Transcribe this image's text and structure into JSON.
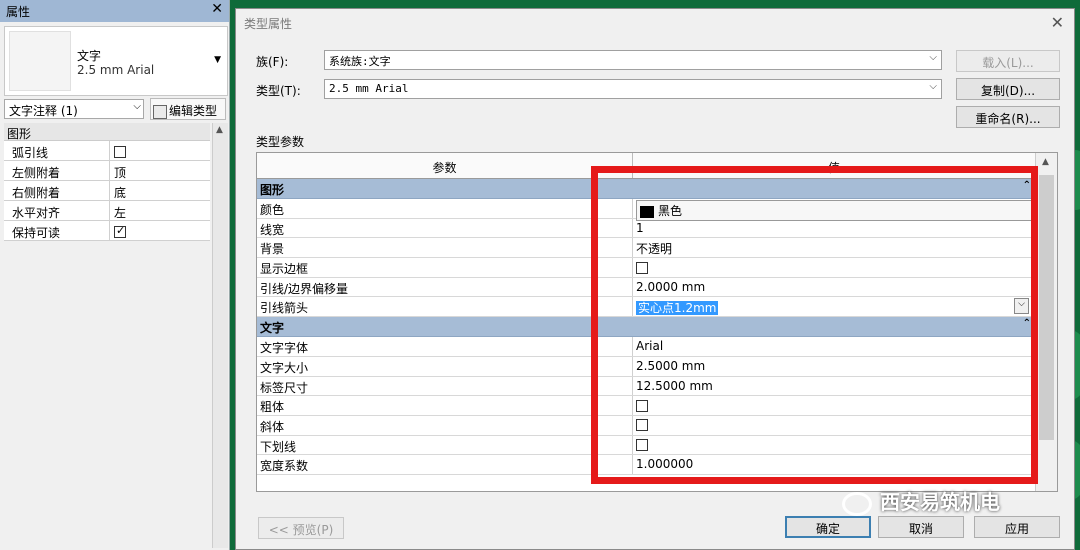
{
  "props_panel": {
    "title": "属性",
    "close_icon": "close-icon",
    "type_name": "文字",
    "type_sub": "2.5 mm Arial",
    "filter": "文字注释 (1)",
    "edit_type_label": "编辑类型",
    "section": "图形",
    "rows": [
      {
        "key": "弧引线",
        "val": ""
      },
      {
        "key": "左侧附着",
        "val": "顶"
      },
      {
        "key": "右侧附着",
        "val": "底"
      },
      {
        "key": "水平对齐",
        "val": "左"
      },
      {
        "key": "保持可读",
        "val": ""
      }
    ]
  },
  "dialog": {
    "title": "类型属性",
    "family_label": "族(F):",
    "family_value": "系统族:文字",
    "type_label": "类型(T):",
    "type_value": "2.5 mm Arial",
    "load_btn": "载入(L)...",
    "copy_btn": "复制(D)...",
    "rename_btn": "重命名(R)...",
    "type_params_label": "类型参数",
    "col_param": "参数",
    "col_value": "值",
    "sections": [
      {
        "name": "图形",
        "rows": [
          {
            "key": "颜色",
            "val": "黑色"
          },
          {
            "key": "线宽",
            "val": "1"
          },
          {
            "key": "背景",
            "val": "不透明"
          },
          {
            "key": "显示边框",
            "val": ""
          },
          {
            "key": "引线/边界偏移量",
            "val": "2.0000 mm"
          },
          {
            "key": "引线箭头",
            "val": "实心点1.2mm"
          }
        ]
      },
      {
        "name": "文字",
        "rows": [
          {
            "key": "文字字体",
            "val": "Arial"
          },
          {
            "key": "文字大小",
            "val": "2.5000 mm"
          },
          {
            "key": "标签尺寸",
            "val": "12.5000 mm"
          },
          {
            "key": "粗体",
            "val": ""
          },
          {
            "key": "斜体",
            "val": ""
          },
          {
            "key": "下划线",
            "val": ""
          },
          {
            "key": "宽度系数",
            "val": "1.000000"
          }
        ]
      }
    ],
    "preview_btn": "<< 预览(P)",
    "ok_btn": "确定",
    "cancel_btn": "取消",
    "apply_btn": "应用"
  },
  "watermark": "西安易筑机电",
  "colors": {
    "highlight": "#e51a1a",
    "section_bg": "#a6bcd6",
    "selection": "#3399ff"
  }
}
